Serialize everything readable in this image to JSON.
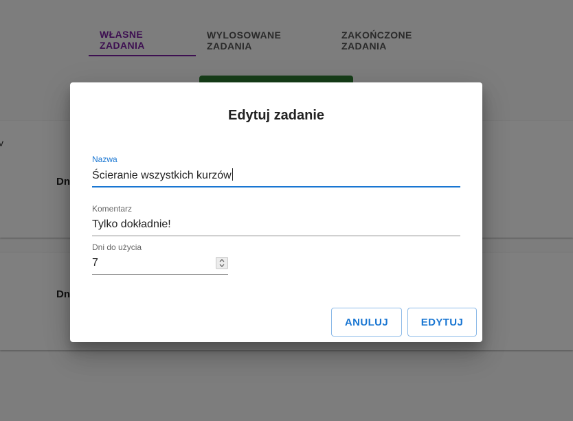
{
  "tabs": [
    {
      "label": "WŁASNE ZADANIA",
      "active": true
    },
    {
      "label": "WYLOSOWANE ZADANIA",
      "active": false
    },
    {
      "label": "ZAKOŃCZONE ZADANIA",
      "active": false
    }
  ],
  "background": {
    "card1_fragment": "v",
    "card1_label": "Dn",
    "card2_label": "Dn"
  },
  "dialog": {
    "title": "Edytuj zadanie",
    "name": {
      "label": "Nazwa",
      "value": "Ścieranie wszystkich kurzów"
    },
    "comment": {
      "label": "Komentarz",
      "value": "Tylko dokładnie!"
    },
    "days": {
      "label": "Dni do użycia",
      "value": "7"
    },
    "cancel_label": "ANULUJ",
    "edit_label": "EDYTUJ"
  },
  "colors": {
    "accent": "#1976d2",
    "tab_active": "#7b1fa2",
    "green_button": "#2e7d32"
  }
}
